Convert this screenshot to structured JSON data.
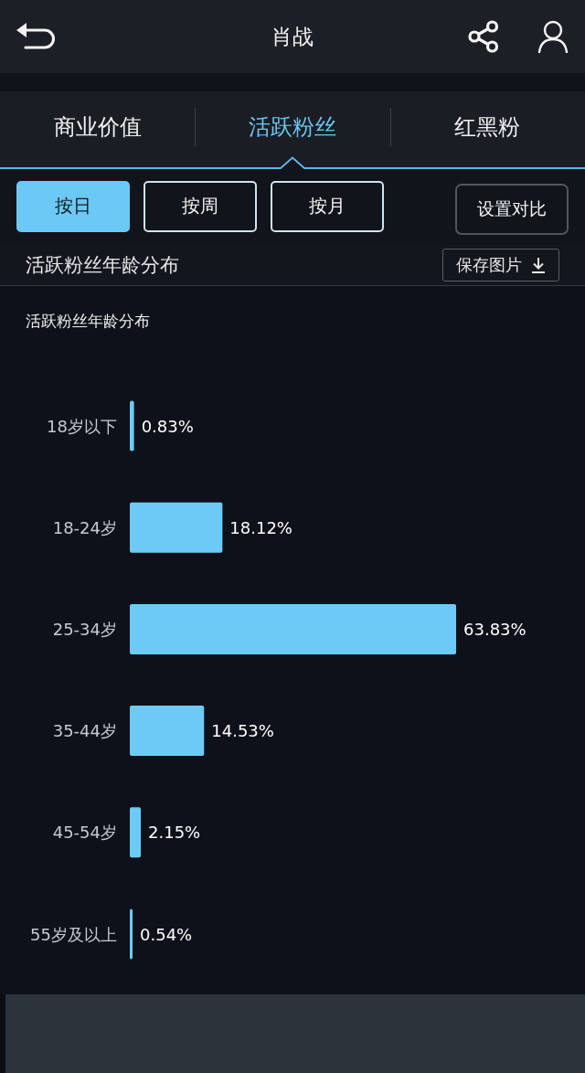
{
  "header": {
    "title": "肖战"
  },
  "tabs": [
    {
      "label": "商业价值",
      "selected": false
    },
    {
      "label": "活跃粉丝",
      "selected": true
    },
    {
      "label": "红黑粉",
      "selected": false
    }
  ],
  "period_buttons": [
    {
      "label": "按日",
      "selected": true
    },
    {
      "label": "按周",
      "selected": false
    },
    {
      "label": "按月",
      "selected": false
    }
  ],
  "compare_button": {
    "label": "设置对比"
  },
  "section": {
    "title": "活跃粉丝年龄分布",
    "save_button": "保存图片"
  },
  "chart": {
    "chart_data": {
      "type": "bar",
      "orientation": "horizontal",
      "title": "活跃粉丝年龄分布",
      "categories": [
        "18岁以下",
        "18-24岁",
        "25-34岁",
        "35-44岁",
        "45-54岁",
        "55岁及以上"
      ],
      "values": [
        0.83,
        18.12,
        63.83,
        14.53,
        2.15,
        0.54
      ],
      "data_labels": true,
      "value_labels": [
        "0.83%",
        "18.12%",
        "63.83%",
        "14.53%",
        "2.15%",
        "0.54%"
      ]
    }
  }
}
